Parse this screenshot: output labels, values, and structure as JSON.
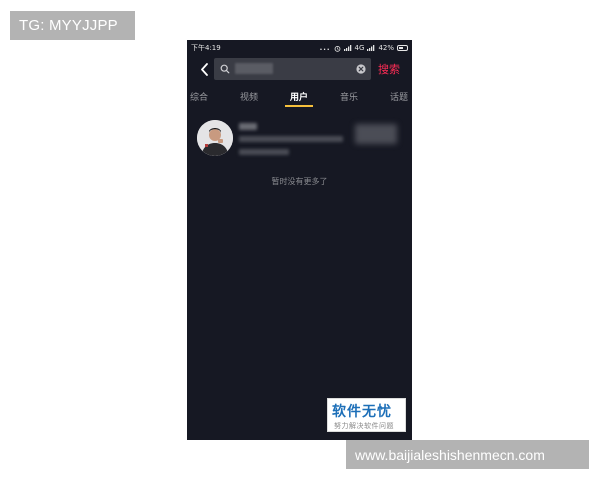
{
  "overlays": {
    "tg_label": "TG: MYYJJPP",
    "url_label": "www.baijialeshishenmecn.com"
  },
  "status_bar": {
    "time": "下午4:19",
    "dots": "...",
    "network": "4G",
    "battery": "42%"
  },
  "search": {
    "value": "加",
    "button_label": "搜索",
    "icons": {
      "back": "chevron-left-icon",
      "search": "search-icon",
      "clear": "clear-icon"
    }
  },
  "tabs": [
    {
      "label": "综合",
      "active": false
    },
    {
      "label": "视频",
      "active": false
    },
    {
      "label": "用户",
      "active": true
    },
    {
      "label": "音乐",
      "active": false
    },
    {
      "label": "话题",
      "active": false
    }
  ],
  "result": {
    "name": "加",
    "info": "2M",
    "meta": ""
  },
  "no_more_text": "暂时没有更多了",
  "watermark": {
    "title": "软件无忧",
    "subtitle": "努力解决软件问题"
  },
  "colors": {
    "background": "#161823",
    "accent": "#fe2c55",
    "tab_indicator": "#f6c03c"
  }
}
